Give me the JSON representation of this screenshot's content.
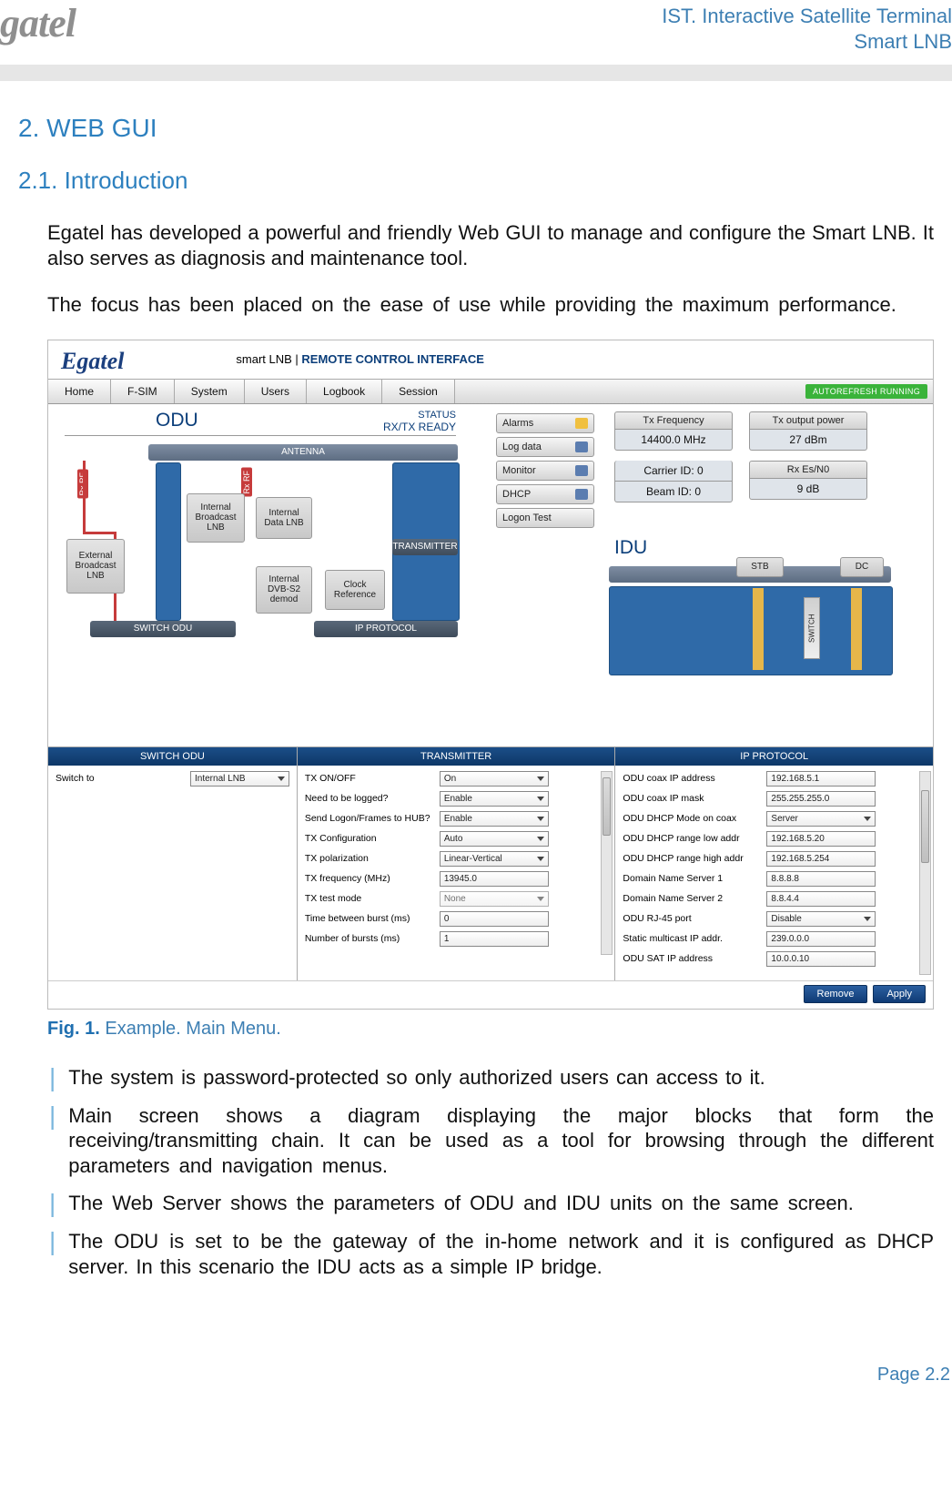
{
  "header": {
    "logo": "gatel",
    "title_line1": "IST. Interactive Satellite Terminal",
    "title_line2": "Smart LNB"
  },
  "section_num": "2.",
  "section_title": "WEB GUI",
  "subsection_num": "2.1.",
  "subsection_title": "Introduction",
  "para1": "Egatel has developed a powerful and friendly Web GUI to manage and configure the Smart LNB. It also serves as diagnosis and maintenance tool.",
  "para2": "The focus has been placed on the ease of use while providing the maximum performance.",
  "screenshot": {
    "brand": "Egatel",
    "title_prefix": "smart LNB | ",
    "title_strong": "REMOTE CONTROL INTERFACE",
    "menu": [
      "Home",
      "F-SIM",
      "System",
      "Users",
      "Logbook",
      "Session"
    ],
    "autorefresh": "AUTOREFRESH RUNNING",
    "odu_title": "ODU",
    "status_label": "STATUS",
    "status_value": "RX/TX READY",
    "antenna": "ANTENNA",
    "boxes": {
      "ext_lnb": "External Broadcast LNB",
      "int_bcast": "Internal Broadcast LNB",
      "int_data": "Internal Data LNB",
      "int_demod": "Internal DVB-S2 demod",
      "clock": "Clock Reference",
      "transmitter": "TRANSMITTER",
      "switch_odu": "SWITCH ODU",
      "ip_protocol": "IP PROTOCOL"
    },
    "rx_rf": "Rx RF",
    "side_buttons": [
      "Alarms",
      "Log data",
      "Monitor",
      "DHCP",
      "Logon Test"
    ],
    "stats": {
      "tx_freq_label": "Tx Frequency",
      "tx_freq_value": "14400.0 MHz",
      "tx_out_label": "Tx output power",
      "tx_out_value": "27 dBm",
      "carrier": "Carrier ID: 0",
      "beam": "Beam ID: 0",
      "rx_esn0_label": "Rx Es/N0",
      "rx_esn0_value": "9 dB"
    },
    "idu_title": "IDU",
    "idu_stb": "STB",
    "idu_dc": "DC",
    "idu_switch": "SWITCH",
    "panels": {
      "switch_odu": {
        "title": "SWITCH ODU",
        "rows": [
          {
            "label": "Switch to",
            "value": "Internal LNB",
            "dd": true
          }
        ]
      },
      "transmitter": {
        "title": "TRANSMITTER",
        "rows": [
          {
            "label": "TX ON/OFF",
            "value": "On",
            "dd": true
          },
          {
            "label": "Need to be logged?",
            "value": "Enable",
            "dd": true
          },
          {
            "label": "Send Logon/Frames to HUB?",
            "value": "Enable",
            "dd": true
          },
          {
            "label": "TX Configuration",
            "value": "Auto",
            "dd": true
          },
          {
            "label": "TX polarization",
            "value": "Linear-Vertical",
            "dd": true
          },
          {
            "label": "TX frequency (MHz)",
            "value": "13945.0",
            "dd": false
          },
          {
            "label": "TX test mode",
            "value": "None",
            "dd": true
          },
          {
            "label": "Time between burst (ms)",
            "value": "0",
            "dd": false
          },
          {
            "label": "Number of bursts (ms)",
            "value": "1",
            "dd": false
          }
        ]
      },
      "ip_protocol": {
        "title": "IP PROTOCOL",
        "rows": [
          {
            "label": "ODU coax IP address",
            "value": "192.168.5.1",
            "dd": false
          },
          {
            "label": "ODU coax IP mask",
            "value": "255.255.255.0",
            "dd": false
          },
          {
            "label": "ODU DHCP Mode on coax",
            "value": "Server",
            "dd": true
          },
          {
            "label": "ODU DHCP range low addr",
            "value": "192.168.5.20",
            "dd": false
          },
          {
            "label": "ODU DHCP range high addr",
            "value": "192.168.5.254",
            "dd": false
          },
          {
            "label": "Domain Name Server 1",
            "value": "8.8.8.8",
            "dd": false
          },
          {
            "label": "Domain Name Server 2",
            "value": "8.8.4.4",
            "dd": false
          },
          {
            "label": "ODU RJ-45 port",
            "value": "Disable",
            "dd": true
          },
          {
            "label": "Static multicast IP addr.",
            "value": "239.0.0.0",
            "dd": false
          },
          {
            "label": "ODU SAT IP address",
            "value": "10.0.0.10",
            "dd": false
          }
        ]
      }
    },
    "actions": {
      "remove": "Remove",
      "apply": "Apply"
    }
  },
  "figure": {
    "num": "Fig. 1.",
    "caption": "Example. Main Menu."
  },
  "bullets": [
    "The system is password-protected so only authorized users can access to it.",
    "Main screen shows a diagram displaying the major blocks that form the receiving/transmitting chain. It can be used as a tool for browsing through the different parameters and navigation menus.",
    "The Web Server shows the parameters of ODU and IDU units on the same screen.",
    "The ODU is set to be the gateway of the in-home network and it is configured as DHCP server. In this scenario the IDU acts as a simple IP bridge."
  ],
  "footer": "Page 2.2"
}
